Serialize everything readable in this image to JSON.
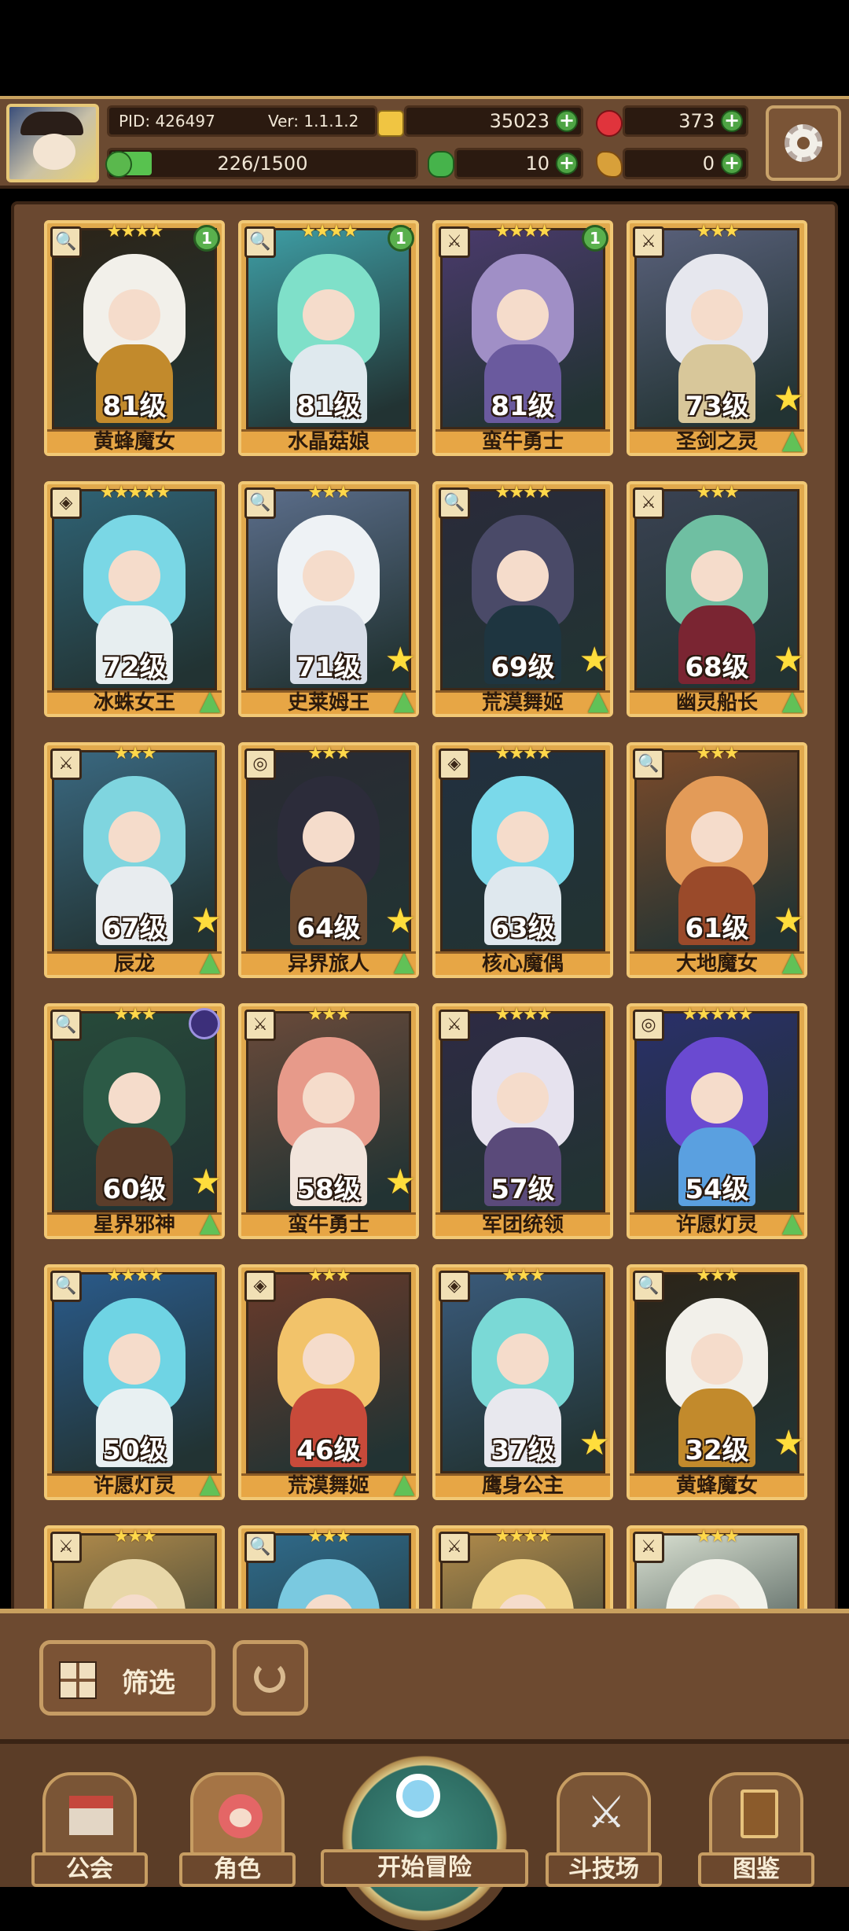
{
  "header": {
    "pid": "PID: 426497",
    "version": "Ver: 1.1.1.2",
    "gold": "35023",
    "gems": "373",
    "stamina": "226/1500",
    "clover": "10",
    "food": "0"
  },
  "cards": [
    {
      "level": "81级",
      "name": "黄蜂魔女",
      "stars": "★★★★",
      "type": "🔍",
      "badge": "1",
      "art": [
        "#2c2418",
        "#f2f0ea",
        "#c28a2c"
      ]
    },
    {
      "level": "81级",
      "name": "水晶菇娘",
      "stars": "★★★★",
      "type": "🔍",
      "badge": "1",
      "art": [
        "#3e9ea5",
        "#7fe0c9",
        "#dfe9ee"
      ]
    },
    {
      "level": "81级",
      "name": "蛮牛勇士",
      "stars": "★★★★",
      "type": "⚔",
      "badge": "1",
      "art": [
        "#4a3a6b",
        "#a08fc6",
        "#6a5a9e"
      ]
    },
    {
      "level": "73级",
      "name": "圣剑之灵",
      "stars": "★★★",
      "type": "⚔",
      "star": true,
      "up": true,
      "art": [
        "#59607a",
        "#e6e7ee",
        "#d8c79a"
      ]
    },
    {
      "level": "72级",
      "name": "冰蛛女王",
      "stars": "★★★★★",
      "type": "◈",
      "up": true,
      "art": [
        "#2f6274",
        "#7ad7e5",
        "#e7eef0"
      ]
    },
    {
      "level": "71级",
      "name": "史莱姆王",
      "stars": "★★★",
      "type": "🔍",
      "star": true,
      "up": true,
      "art": [
        "#5b6d8a",
        "#eef2f5",
        "#d7dde8"
      ]
    },
    {
      "level": "69级",
      "name": "荒漠舞姬",
      "stars": "★★★★",
      "type": "🔍",
      "star": true,
      "up": true,
      "art": [
        "#2a2a3a",
        "#4a4a68",
        "#1e3540"
      ]
    },
    {
      "level": "68级",
      "name": "幽灵船长",
      "stars": "★★★",
      "type": "⚔",
      "star": true,
      "up": true,
      "art": [
        "#3a4252",
        "#6fbfa2",
        "#7a2532"
      ]
    },
    {
      "level": "67级",
      "name": "辰龙",
      "stars": "★★★",
      "type": "⚔",
      "star": true,
      "up": true,
      "art": [
        "#3a6880",
        "#7fd5df",
        "#e8ecef"
      ]
    },
    {
      "level": "64级",
      "name": "异界旅人",
      "stars": "★★★",
      "type": "◎",
      "star": true,
      "up": true,
      "art": [
        "#2a2a33",
        "#2c2c3a",
        "#6b4a30"
      ]
    },
    {
      "level": "63级",
      "name": "核心魔偶",
      "stars": "★★★★",
      "type": "◈",
      "art": [
        "#22303f",
        "#7ad9ea",
        "#dfe8ee"
      ]
    },
    {
      "level": "61级",
      "name": "大地魔女",
      "stars": "★★★",
      "type": "🔍",
      "star": true,
      "up": true,
      "art": [
        "#7a4a2a",
        "#e39b58",
        "#9a4a2a"
      ]
    },
    {
      "level": "60级",
      "name": "星界邪神",
      "stars": "★★★",
      "type": "🔍",
      "star": true,
      "up": true,
      "extra": true,
      "art": [
        "#274a3a",
        "#2c5a46",
        "#5b3d2a"
      ]
    },
    {
      "level": "58级",
      "name": "蛮牛勇士",
      "stars": "★★★",
      "type": "⚔",
      "star": true,
      "art": [
        "#6a4a3a",
        "#e79a8a",
        "#f2e5dc"
      ]
    },
    {
      "level": "57级",
      "name": "军团统领",
      "stars": "★★★★",
      "type": "⚔",
      "art": [
        "#2e2a44",
        "#e6e2ee",
        "#5a4a7a"
      ]
    },
    {
      "level": "54级",
      "name": "许愿灯灵",
      "stars": "★★★★★",
      "type": "◎",
      "up": true,
      "art": [
        "#2a2f6a",
        "#6a4ad1",
        "#5aa0e0"
      ]
    },
    {
      "level": "50级",
      "name": "许愿灯灵",
      "stars": "★★★★",
      "type": "🔍",
      "up": true,
      "art": [
        "#2a5a8a",
        "#6fd4e4",
        "#e8f0f2"
      ]
    },
    {
      "level": "46级",
      "name": "荒漠舞姬",
      "stars": "★★★",
      "type": "◈",
      "up": true,
      "art": [
        "#6a3a2a",
        "#f2c36a",
        "#c84a3a"
      ]
    },
    {
      "level": "37级",
      "name": "鹰身公主",
      "stars": "★★★",
      "type": "◈",
      "star": true,
      "art": [
        "#3a5a7a",
        "#7ad9d6",
        "#e8e8ee"
      ]
    },
    {
      "level": "32级",
      "name": "黄蜂魔女",
      "stars": "★★★",
      "type": "🔍",
      "star": true,
      "art": [
        "#2c2418",
        "#f2f0ea",
        "#c28a2c"
      ]
    },
    {
      "level": "",
      "name": "",
      "stars": "★★★",
      "type": "⚔",
      "art": [
        "#b08a4a",
        "#e8d7a8",
        "#c8a26a"
      ]
    },
    {
      "level": "",
      "name": "",
      "stars": "★★★",
      "type": "🔍",
      "art": [
        "#2f6a8a",
        "#7ac9e0",
        "#a8e0f0"
      ]
    },
    {
      "level": "",
      "name": "",
      "stars": "★★★★",
      "type": "⚔",
      "art": [
        "#b08a4a",
        "#f0d48a",
        "#e8c87a"
      ]
    },
    {
      "level": "",
      "name": "",
      "stars": "★★★",
      "type": "⚔",
      "art": [
        "#d8dfd0",
        "#f2f2ea",
        "#8ac79a"
      ]
    }
  ],
  "filter": {
    "label": "筛选"
  },
  "nav": {
    "guild": "公会",
    "role": "角色",
    "adventure": "开始冒险",
    "arena": "斗技场",
    "codex": "图鉴"
  }
}
